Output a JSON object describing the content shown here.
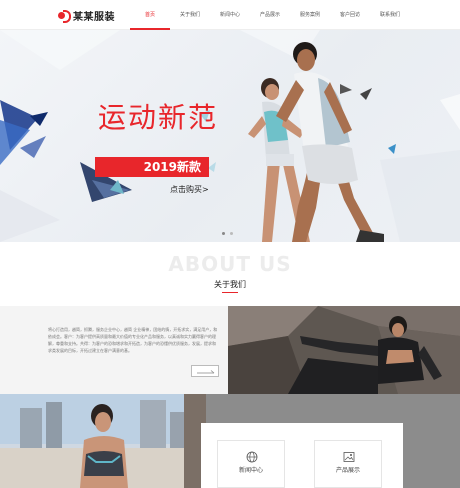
{
  "header": {
    "logo_text": "某某服装",
    "nav": [
      {
        "label": "首页",
        "active": true
      },
      {
        "label": "关于我们",
        "active": false
      },
      {
        "label": "新闻中心",
        "active": false
      },
      {
        "label": "产品展示",
        "active": false
      },
      {
        "label": "服务案例",
        "active": false
      },
      {
        "label": "客户回访",
        "active": false
      },
      {
        "label": "联系我们",
        "active": false
      }
    ]
  },
  "banner": {
    "title": "运动新范",
    "tag": "2019新款",
    "link": "点击购买>",
    "slide_count": 2,
    "active_slide": 1
  },
  "about": {
    "heading": "ABOUT US",
    "subtitle": "关于我们",
    "paragraph": "将心打造用，越简，抓腾，服务企业中心，越简 企业精神，团结的情，开拓求实，满足用户，和依成会。客户：为客户提供高质量和最大价值的专业化产品和服务，以真诚和实力赢得客户的理解，尊重和支持。共得：为客户的恐和增求和开拓造，为客户的恐懂供优质服务，发展，提求和求类发展的目标，开拓过建立在客户满意的基。",
    "more_icon": "arrow-right-icon"
  },
  "cards": [
    {
      "label": "新闻中心",
      "icon": "globe-icon"
    },
    {
      "label": "产品展示",
      "icon": "image-icon"
    }
  ],
  "colors": {
    "accent": "#e8262b",
    "dark": "#222222",
    "panel_bg": "#f4f4f4"
  }
}
